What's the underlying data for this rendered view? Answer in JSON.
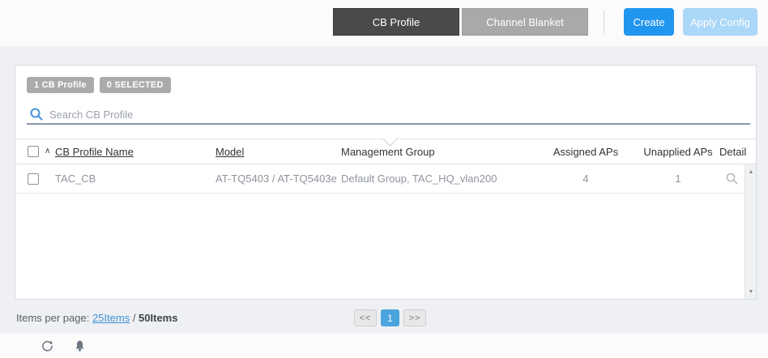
{
  "tabs": [
    {
      "label": "CB Profile",
      "active": true
    },
    {
      "label": "Channel Blanket",
      "active": false
    }
  ],
  "actions": {
    "create_label": "Create",
    "apply_config_label": "Apply Config"
  },
  "panel": {
    "badges": [
      {
        "label": "1 CB Profile"
      },
      {
        "label": "0 SELECTED"
      }
    ],
    "search": {
      "placeholder": "Search CB Profile"
    },
    "table": {
      "sort_indicator": "∧",
      "columns": [
        "CB Profile Name",
        "Model",
        "Management Group",
        "Assigned APs",
        "Unapplied APs",
        "Detail"
      ],
      "rows": [
        {
          "name": "TAC_CB",
          "model": "AT-TQ5403 / AT-TQ5403e",
          "management_group": "Default Group, TAC_HQ_vlan200",
          "assigned_aps": "4",
          "unapplied_aps": "1"
        }
      ]
    },
    "scrollbar": {
      "up": "▲",
      "down": "▼"
    }
  },
  "footer": {
    "items_per_page_label": "Items per page:",
    "current_option": "25Items",
    "separator": " / ",
    "max_option": "50Items",
    "pagination": {
      "prev": "<<",
      "page": "1",
      "next": ">>"
    }
  },
  "colors": {
    "accent_blue": "#2196ef",
    "disabled_blue": "#abd7f8",
    "active_tab": "#4a4a4a",
    "inactive_tab": "#a9a9a9",
    "badge_gray": "#ababab",
    "pagination_active": "#4aa4dd",
    "search_underline": "#8d99a7"
  }
}
